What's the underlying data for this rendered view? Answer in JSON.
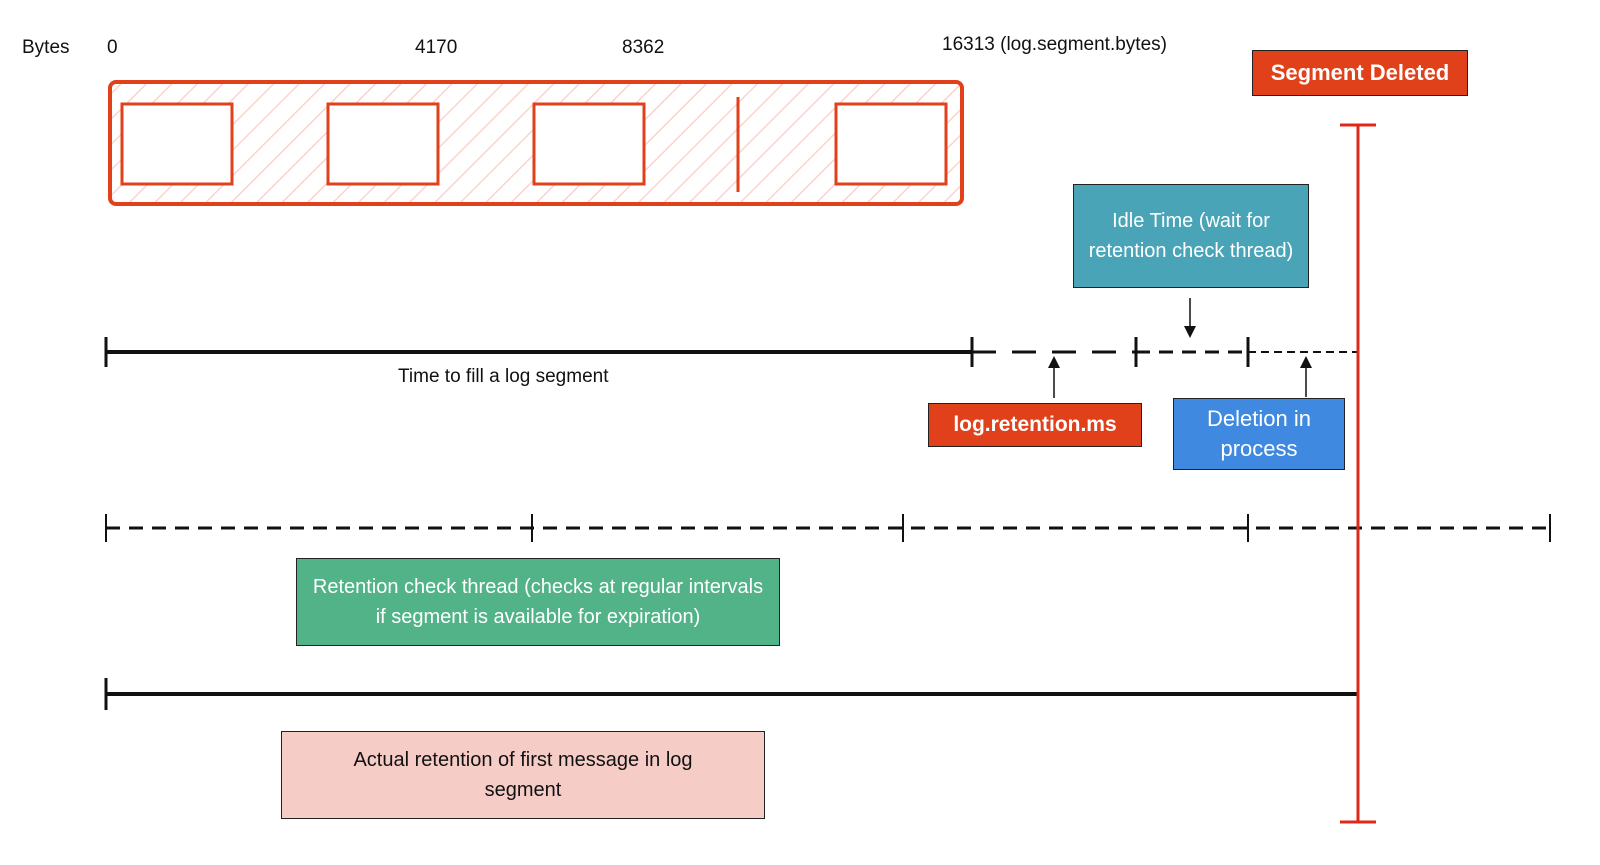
{
  "byte_axis": {
    "label": "Bytes",
    "ticks": [
      "0",
      "4170",
      "8362",
      "16313 (log.segment.bytes)"
    ]
  },
  "segment": {
    "message_blocks": 4,
    "divider_after_block": 3
  },
  "labels": {
    "segment_deleted": "Segment Deleted",
    "time_to_fill": "Time to fill a log segment",
    "log_retention_ms": "log.retention.ms",
    "idle_time": "Idle Time (wait for retention check thread)",
    "deletion_in_process": "Deletion in process",
    "retention_check_thread": "Retention check thread (checks at regular intervals if segment is available for expiration)",
    "actual_retention": "Actual retention of first message in log segment"
  },
  "colors": {
    "segment_red": "#e0401a",
    "hatch": "#fbd4cc",
    "idle_teal": "#4aa4b8",
    "deletion_blue": "#3f8ae0",
    "retention_green": "#52b389",
    "actual_pink": "#f6cdc6",
    "deleted_line": "#e0281a"
  }
}
